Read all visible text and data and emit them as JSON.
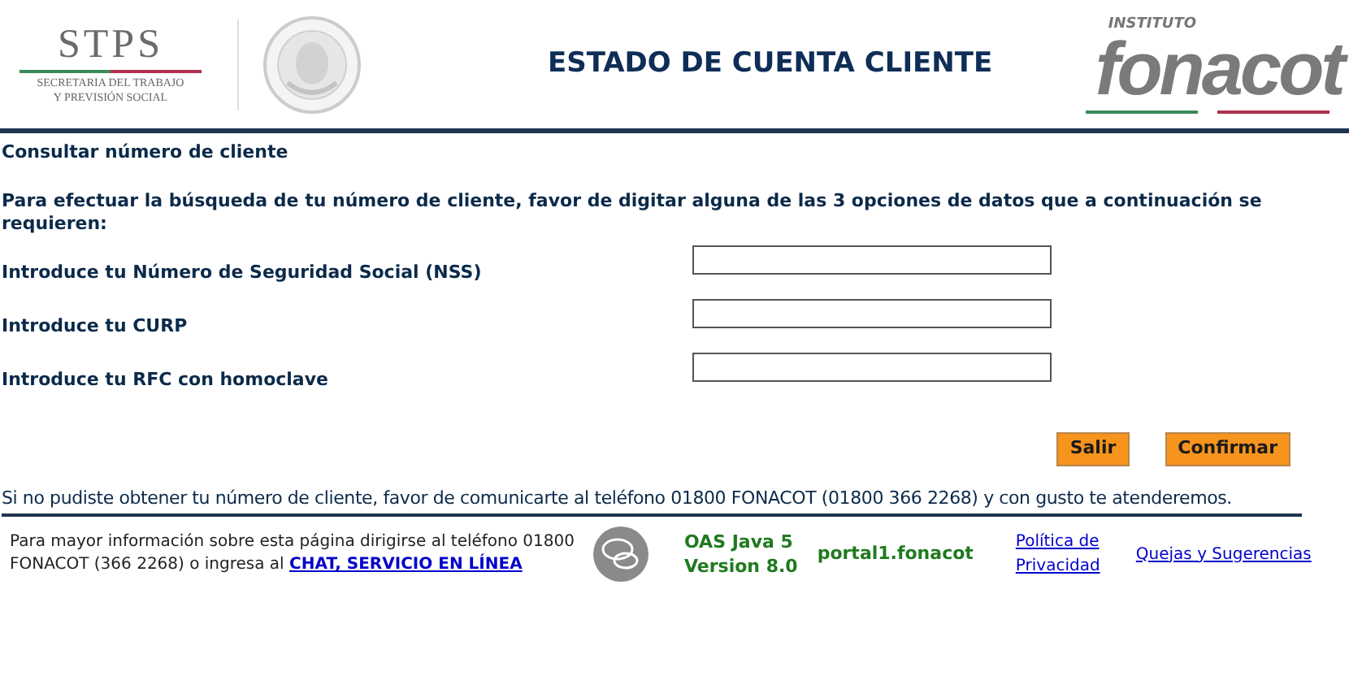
{
  "header": {
    "left_logo": {
      "name": "STPS",
      "line_1": "SECRETARIA DEL TRABAJO",
      "line_2": "Y PREVISIÓN SOCIAL"
    },
    "title": "ESTADO DE CUENTA CLIENTE",
    "right_logo": {
      "small": "INSTITUTO",
      "name": "fonacot"
    }
  },
  "section_title": "Consultar número de cliente",
  "instructions": "Para efectuar la búsqueda de tu número de cliente, favor de digitar alguna de las 3 opciones de datos que a continuación se requieren:",
  "fields": [
    {
      "label": "Introduce tu Número de Seguridad Social (NSS)"
    },
    {
      "label": "Introduce tu CURP"
    },
    {
      "label": "Introduce tu RFC con homoclave"
    }
  ],
  "buttons": [
    "Salir",
    "Confirmar"
  ],
  "help_note": "Si no pudiste obtener tu número de cliente, favor de comunicarte al teléfono 01800 FONACOT (01800 366 2268) y con gusto te atenderemos.",
  "footer": {
    "info": "Para mayor información sobre esta página dirigirse al teléfono 01800 FONACOT (366 2268) o ingresa al",
    "chat_link": "CHAT, SERVICIO EN LÍNEA",
    "version_line_1": "OAS Java 5",
    "version_line_2": "Version 8.0",
    "server": "portal1.fonacot",
    "privacy_link": "Política de Privacidad",
    "complaints_link": "Quejas y Sugerencias"
  }
}
